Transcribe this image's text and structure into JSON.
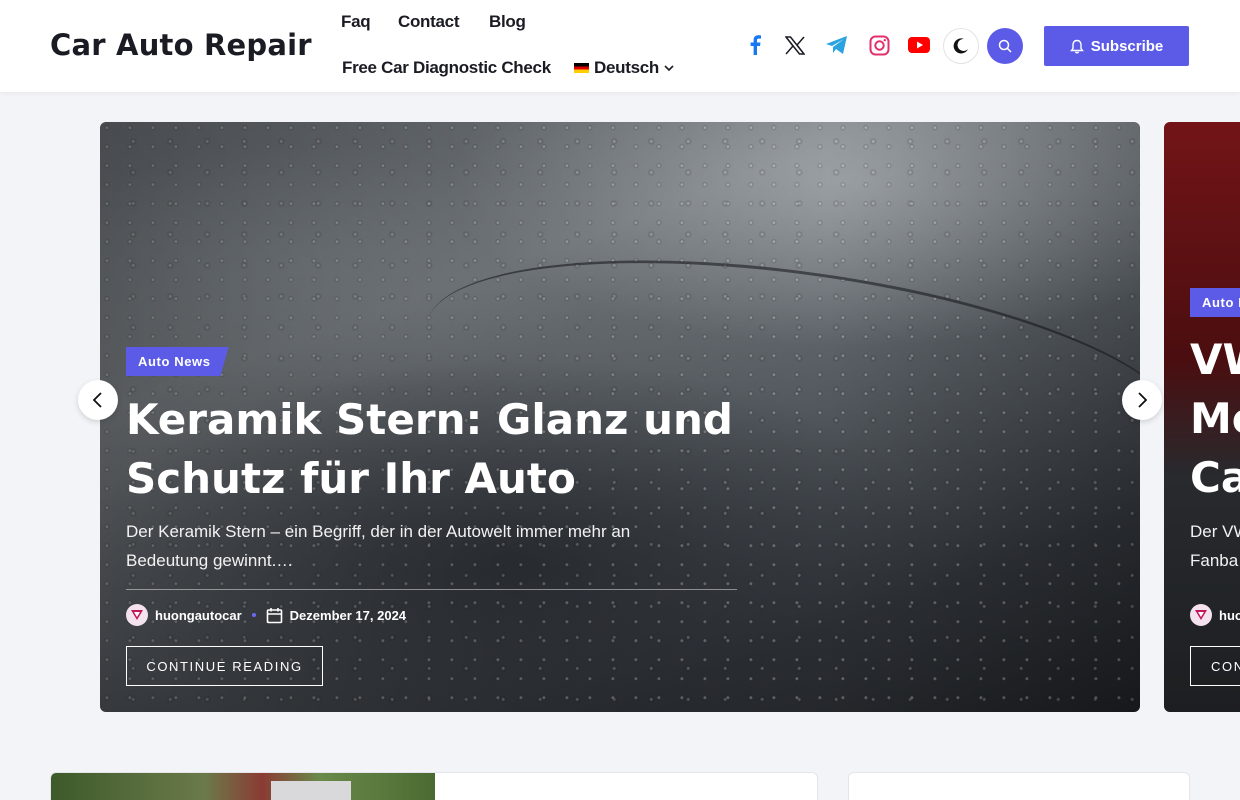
{
  "header": {
    "site_title": "Car Auto Repair",
    "nav": {
      "faq": "Faq",
      "contact": "Contact",
      "blog": "Blog",
      "diagnostic": "Free Car Diagnostic Check",
      "language": "Deutsch"
    },
    "social_icons": [
      "facebook-icon",
      "x-icon",
      "telegram-icon",
      "instagram-icon",
      "youtube-icon"
    ],
    "subscribe_label": "Subscribe",
    "accent_color": "#5b5be8"
  },
  "slider": {
    "slides": [
      {
        "category": "Auto News",
        "title_line1": "Keramik Stern: Glanz und",
        "title_line2": "Schutz für Ihr Auto",
        "excerpt_line1": "Der Keramik Stern – ein Begriff, der in der Autowelt immer mehr an",
        "excerpt_line2": "Bedeutung gewinnt.…",
        "author": "huongautocar",
        "date": "Dezember 17, 2024",
        "button": "CONTINUE READING"
      },
      {
        "category": "Auto I",
        "title_line1": "VW",
        "title_line2": "Me",
        "title_line3": "Ca",
        "excerpt_line1": "Der VW",
        "excerpt_line2": "Fanba",
        "author": "huo",
        "button": "CON"
      }
    ]
  }
}
